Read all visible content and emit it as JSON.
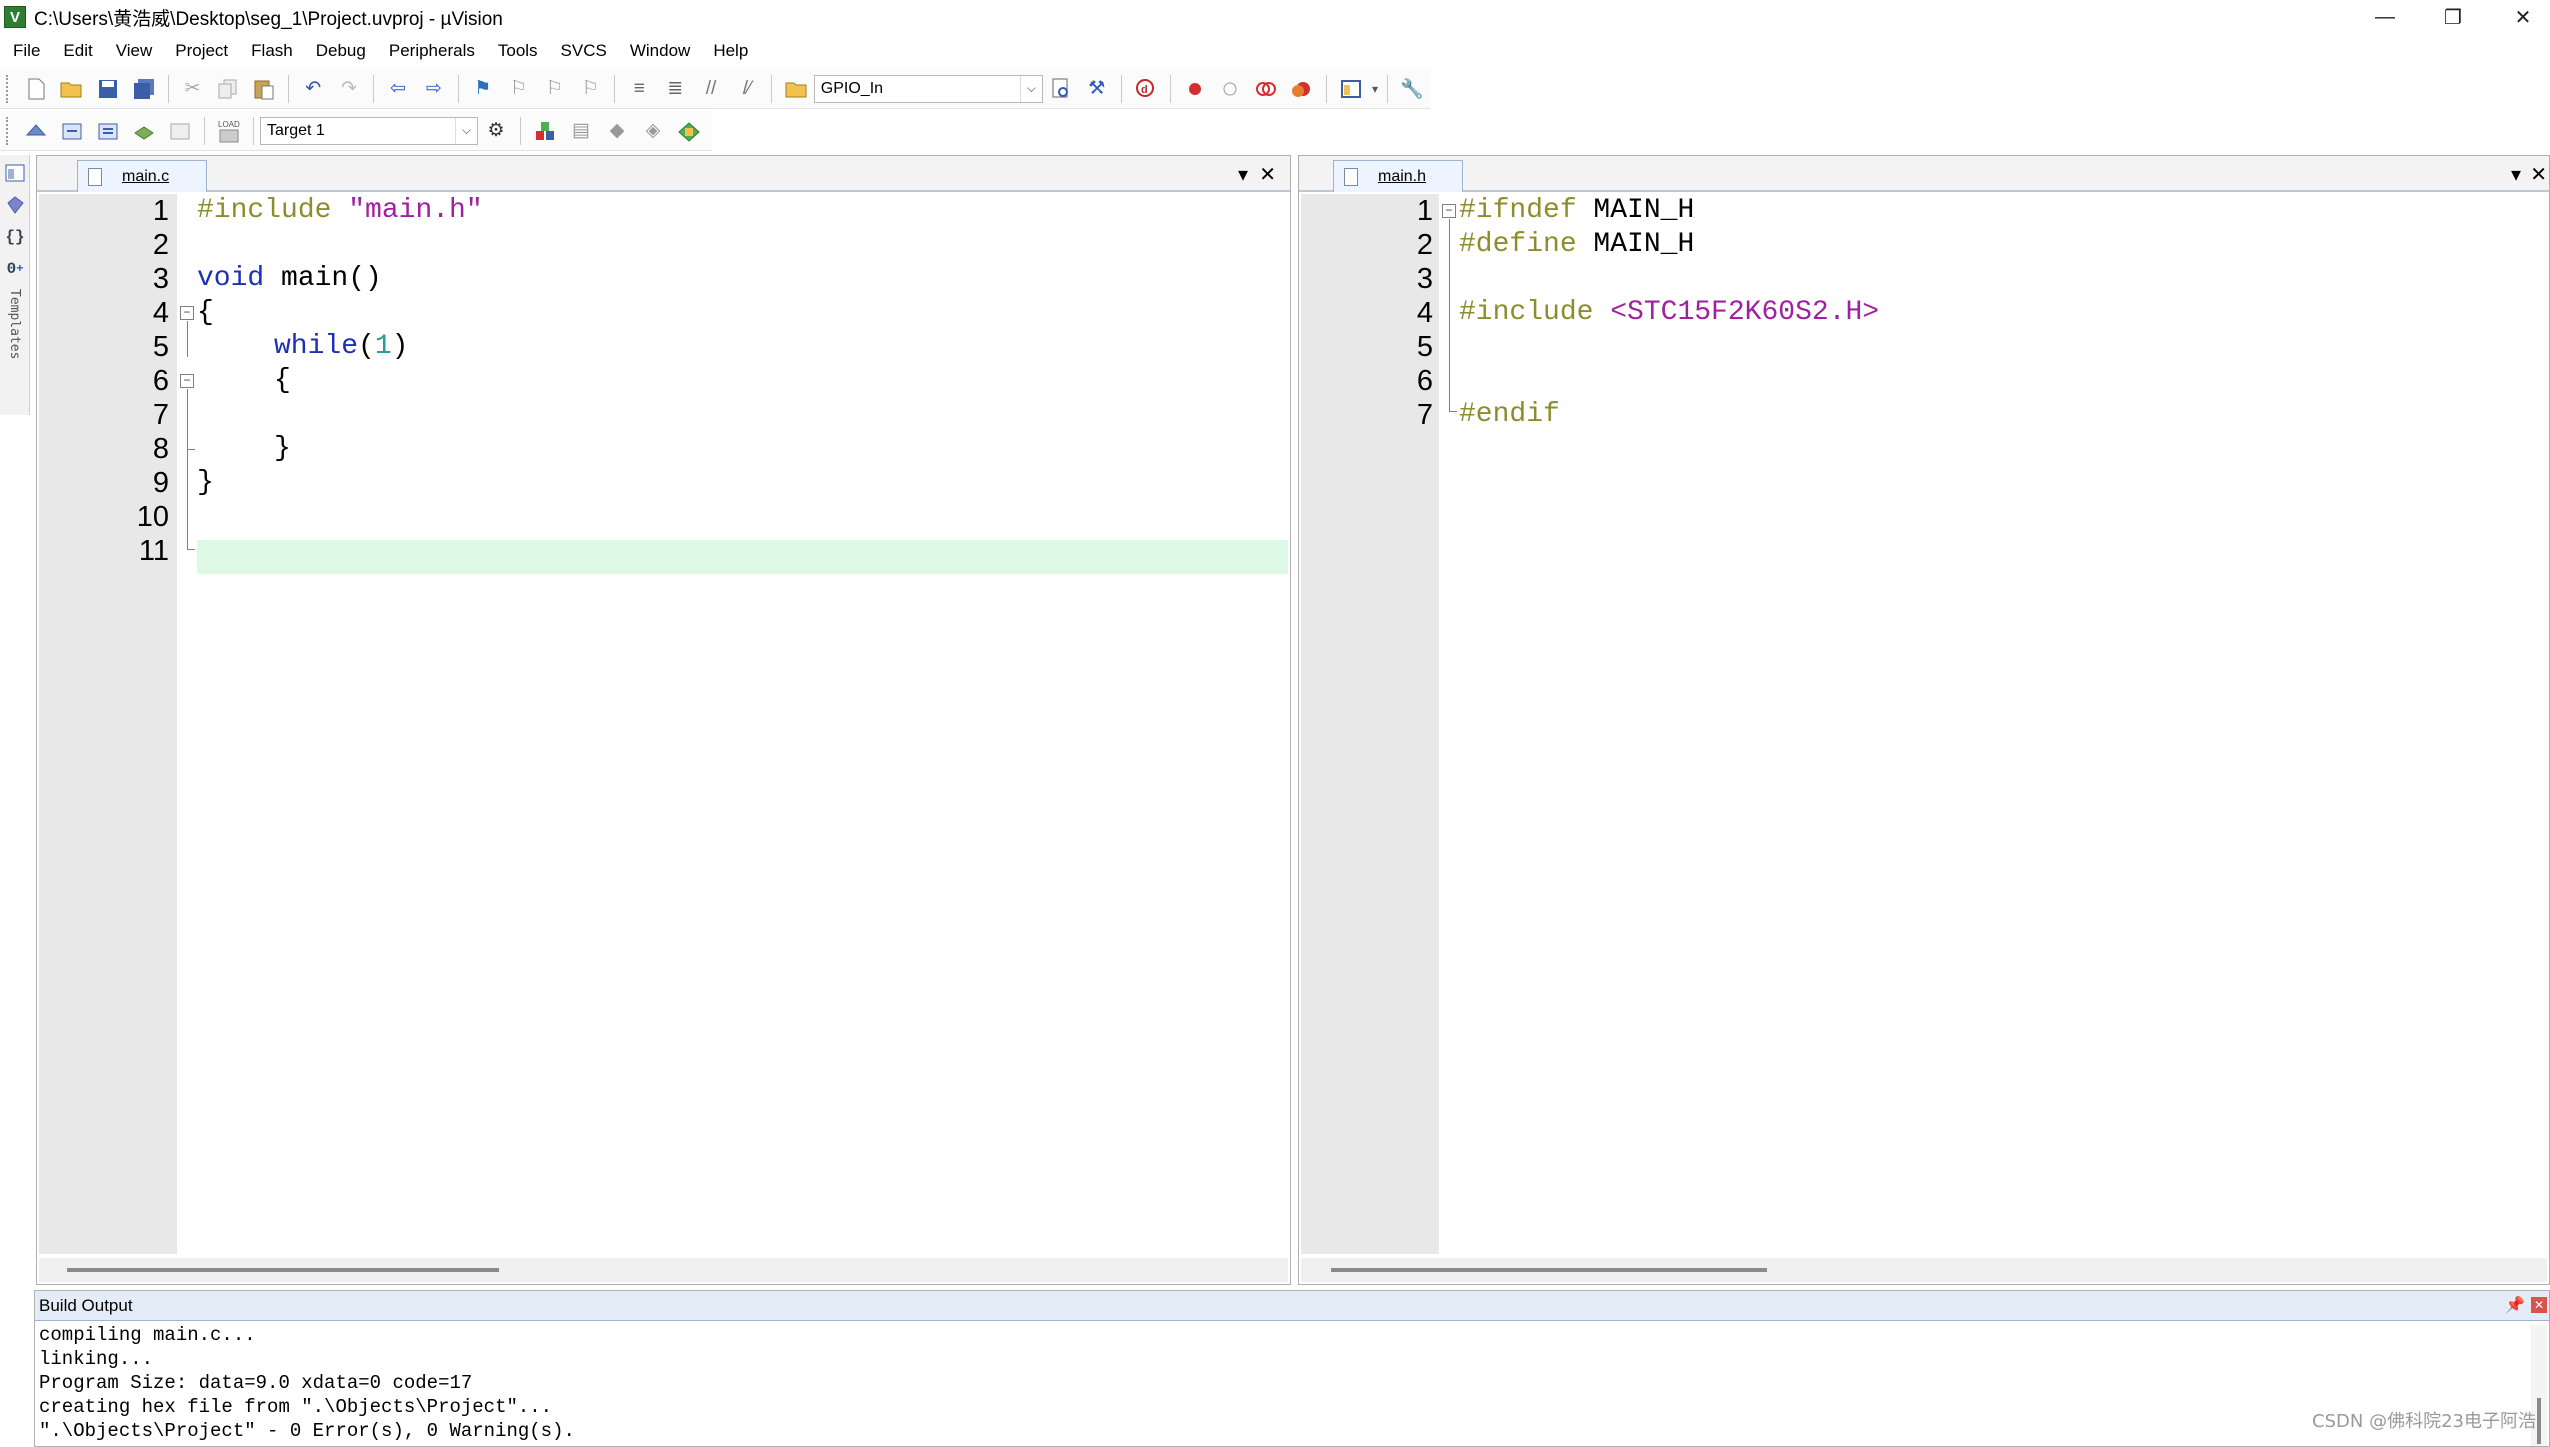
{
  "window": {
    "title": "C:\\Users\\黄浩威\\Desktop\\seg_1\\Project.uvproj - µVision",
    "app_icon": "V",
    "controls": [
      "—",
      "❐",
      "✕"
    ]
  },
  "menubar": {
    "items": [
      {
        "label": "File",
        "icon": "none"
      },
      {
        "label": "Edit"
      },
      {
        "label": "View"
      },
      {
        "label": "Project"
      },
      {
        "label": "Flash"
      },
      {
        "label": "Debug"
      },
      {
        "label": "Peripherals"
      },
      {
        "label": "Tools"
      },
      {
        "label": "SVCS"
      },
      {
        "label": "Window"
      },
      {
        "label": "Help"
      }
    ]
  },
  "toolbar1": {
    "find_combo_value": "GPIO_In"
  },
  "toolbar2": {
    "load_label": "LOAD",
    "target_combo_value": "Target 1"
  },
  "left_strip": {
    "templates_label": "Templates"
  },
  "editor_left": {
    "tab_label": "main.c",
    "lines": [
      {
        "n": "1",
        "text": ""
      },
      {
        "n": "2",
        "text": ""
      },
      {
        "n": "3",
        "text": ""
      },
      {
        "n": "4",
        "text": ""
      },
      {
        "n": "5",
        "text": ""
      },
      {
        "n": "6",
        "text": ""
      },
      {
        "n": "7",
        "text": ""
      },
      {
        "n": "8",
        "text": ""
      },
      {
        "n": "9",
        "text": ""
      },
      {
        "n": "10",
        "text": ""
      },
      {
        "n": "11",
        "text": ""
      }
    ],
    "code": {
      "l1_directive": "#include",
      "l1_string": "\"main.h\"",
      "l3_keyword": "void",
      "l3_rest": " main()",
      "l4": "{",
      "l5_keyword": "while",
      "l5_open": "(",
      "l5_num": "1",
      "l5_close": ")",
      "l6": "{",
      "l8": "}",
      "l9": "}"
    },
    "current_line": 11
  },
  "editor_right": {
    "tab_label": "main.h",
    "line_numbers": [
      "1",
      "2",
      "3",
      "4",
      "5",
      "6",
      "7"
    ],
    "code": {
      "l1_directive": "#ifndef",
      "l1_rest": " MAIN_H",
      "l2_directive": "#define",
      "l2_rest": " MAIN_H",
      "l4_directive": "#include",
      "l4_header": "<STC15F2K60S2.H>",
      "l7_directive": "#endif"
    }
  },
  "build_output": {
    "title": "Build Output",
    "lines": [
      "compiling main.c...",
      "linking...",
      "Program Size: data=9.0 xdata=0 code=17",
      "creating hex file from \".\\Objects\\Project\"...",
      "\".\\Objects\\Project\" - 0 Error(s), 0 Warning(s)."
    ]
  },
  "watermark": "CSDN @佛科院23电子阿浩",
  "colors": {
    "preprocessor": "#8d8d2d",
    "string": "#a020a0",
    "keyword": "#1d2fb8",
    "number": "#2b9a9a",
    "current_line_bg": "#ddf8e4"
  }
}
